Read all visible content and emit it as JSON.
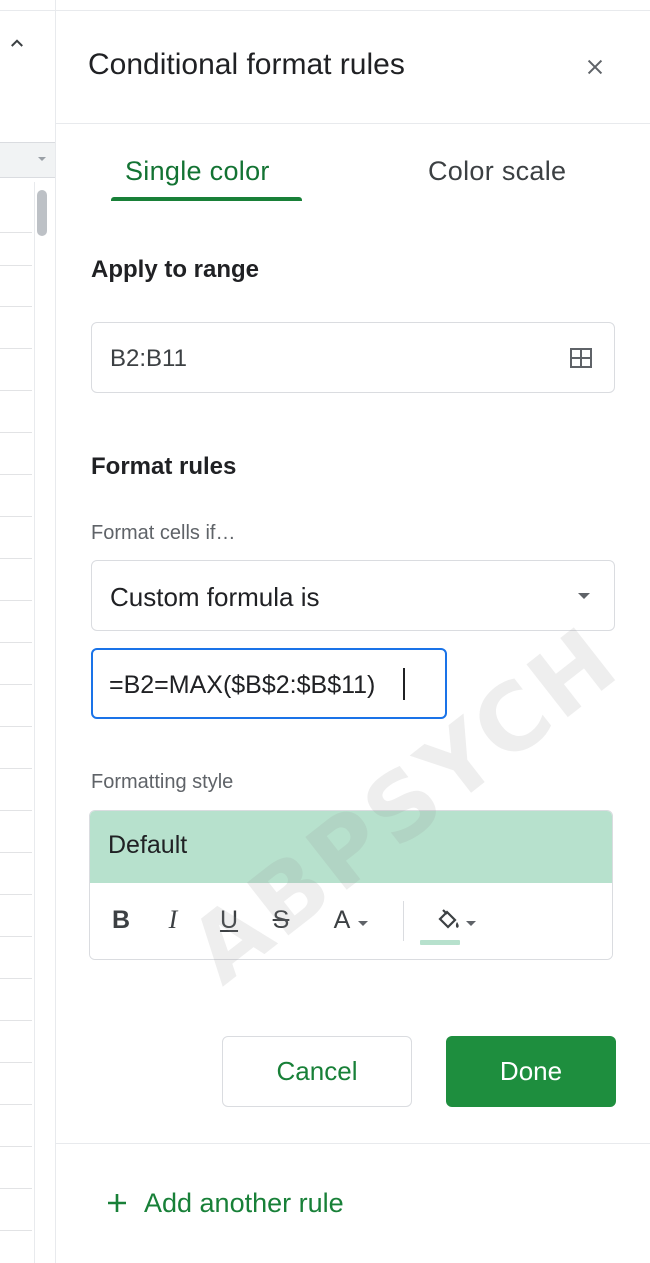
{
  "panel": {
    "title": "Conditional format rules",
    "tabs": [
      {
        "label": "Single color",
        "active": true
      },
      {
        "label": "Color scale",
        "active": false
      }
    ]
  },
  "apply_range": {
    "label": "Apply to range",
    "value": "B2:B11",
    "icon": "grid-select-icon"
  },
  "format_rules": {
    "label": "Format rules",
    "cells_if_label": "Format cells if…",
    "condition": "Custom formula is",
    "formula": "=B2=MAX($B$2:$B$11)"
  },
  "formatting_style": {
    "label": "Formatting style",
    "preset": "Default",
    "preview_color": "#b7e1cd",
    "toolbar": {
      "bold": "B",
      "italic": "I",
      "underline": "U",
      "strikethrough": "S",
      "text_color": "A"
    }
  },
  "actions": {
    "cancel": "Cancel",
    "done": "Done"
  },
  "add_rule": "Add another rule",
  "watermark": "ABPSYCH",
  "colors": {
    "accent_green": "#188038",
    "done_green": "#1e8e3e",
    "focus_blue": "#1a73e8"
  }
}
